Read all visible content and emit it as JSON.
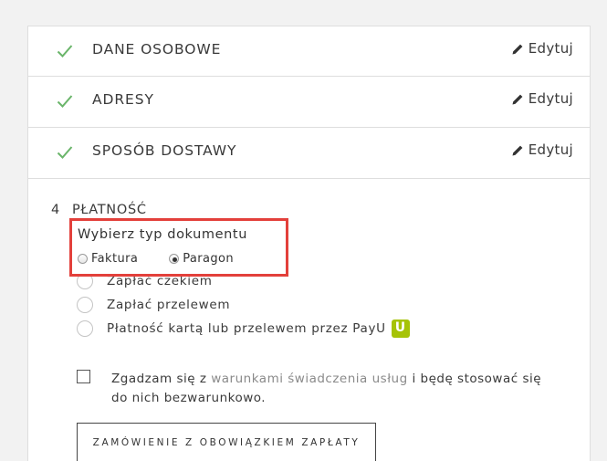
{
  "steps": [
    {
      "title": "DANE OSOBOWE",
      "edit_label": "Edytuj",
      "icon": "check-icon"
    },
    {
      "title": "ADRESY",
      "edit_label": "Edytuj",
      "icon": "check-icon"
    },
    {
      "title": "SPOSÓB DOSTAWY",
      "edit_label": "Edytuj",
      "icon": "check-icon"
    }
  ],
  "payment": {
    "step_number": "4",
    "step_title": "PŁATNOŚĆ",
    "document_type": {
      "title": "Wybierz typ dokumentu",
      "options": [
        "Faktura",
        "Paragon"
      ],
      "selected": "Paragon"
    },
    "methods": [
      "Zapłać czekiem",
      "Zapłać przelewem",
      "Płatność kartą lub przelewem przez PayU"
    ],
    "payu_badge": "U"
  },
  "agreement": {
    "prefix": "Zgadzam się z ",
    "link": "warunkami świadczenia usług",
    "suffix": " i będę stosować się do nich bezwarunkowo.",
    "checked": false
  },
  "order_button_label": "ZAMÓWIENIE Z OBOWIĄZKIEM ZAPŁATY",
  "colors": {
    "check": "#6ab56a",
    "highlight_border": "#e3403b",
    "payu_badge": "#a6c307",
    "link": "#8a8a8a"
  }
}
